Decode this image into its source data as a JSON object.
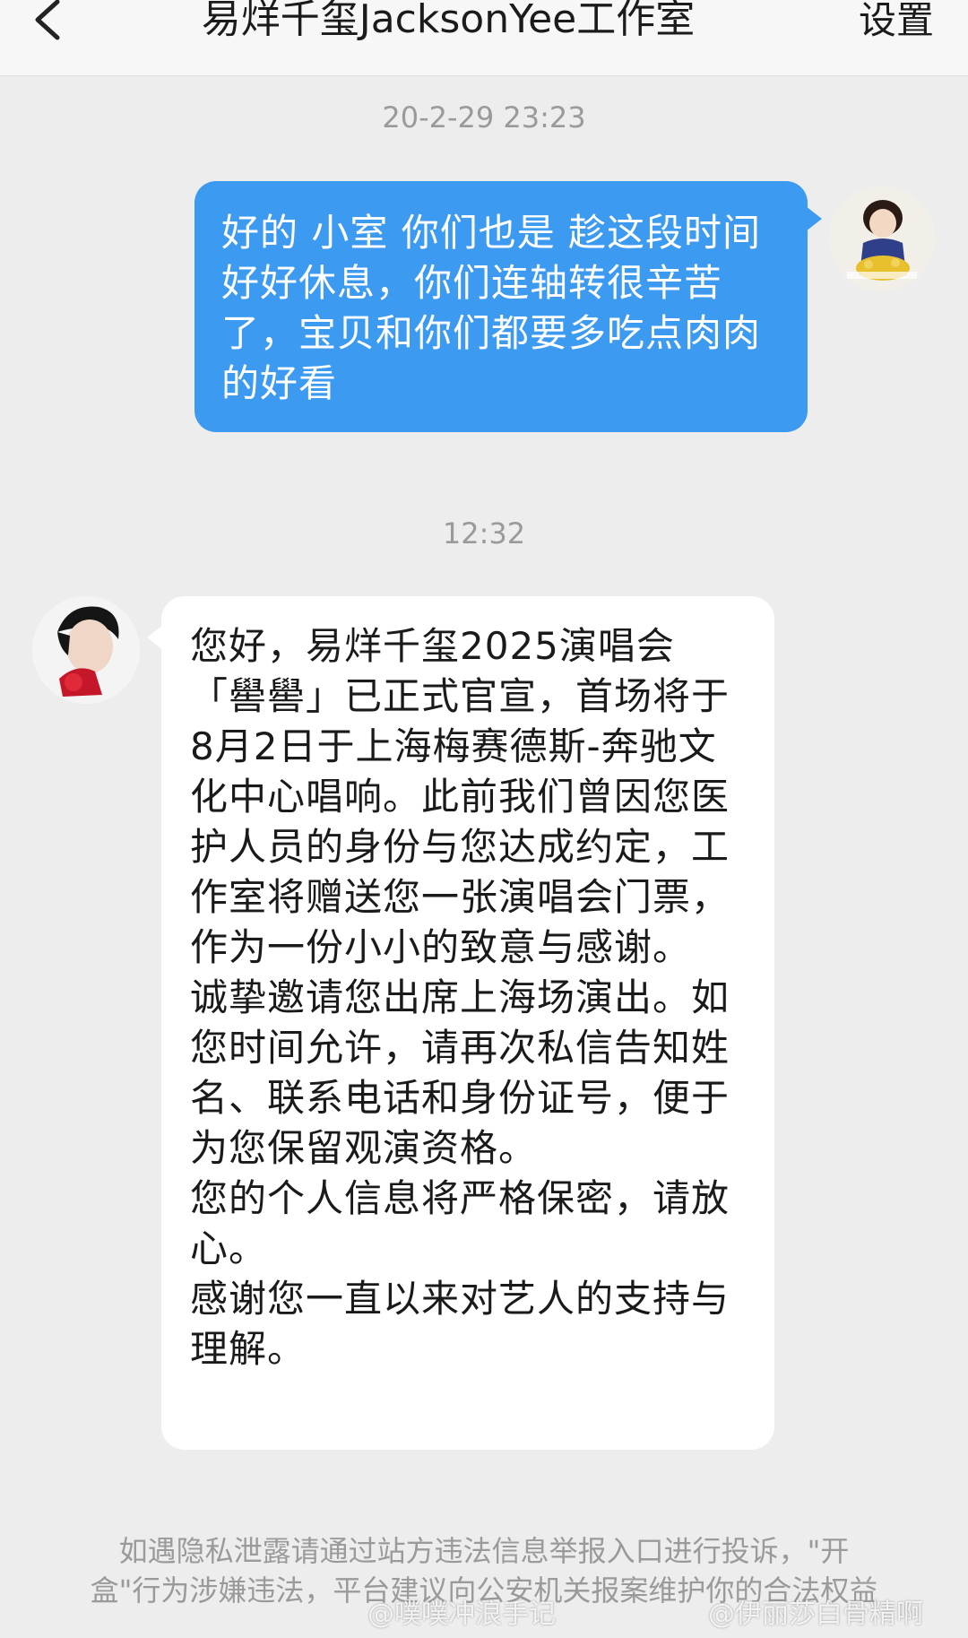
{
  "header": {
    "back_icon": "chevron-left-icon",
    "title": "易烊千玺JacksonYee工作室",
    "settings_label": "设置"
  },
  "messages": [
    {
      "timestamp": "20-2-29 23:23",
      "sender": "self",
      "text": "好的 小室 你们也是 趁这段时间好好休息，你们连轴转很辛苦了，宝贝和你们都要多吃点肉肉的好看"
    },
    {
      "timestamp": "12:32",
      "sender": "studio",
      "text": "您好，易烊千玺2025演唱会「嚳嚳」已正式官宣，首场将于8月2日于上海梅赛德斯-奔驰文化中心唱响。此前我们曾因您医护人员的身份与您达成约定，工作室将赠送您一张演唱会门票，作为一份小小的致意与感谢。\n诚挚邀请您出席上海场演出。如您时间允许，请再次私信告知姓名、联系电话和身份证号，便于为您保留观演资格。\n您的个人信息将严格保密，请放心。\n感谢您一直以来对艺人的支持与理解。"
    }
  ],
  "privacy_notice": "如遇隐私泄露请通过站方违法信息举报入口进行投诉，\"开盒\"行为涉嫌违法，平台建议向公安机关报案维护你的合法权益",
  "watermarks": [
    "@噗噗冲浪手记",
    "@伊丽莎白骨精啊"
  ],
  "colors": {
    "outgoing_bubble": "#3c9af0",
    "incoming_bubble": "#ffffff",
    "background": "#ededed"
  }
}
